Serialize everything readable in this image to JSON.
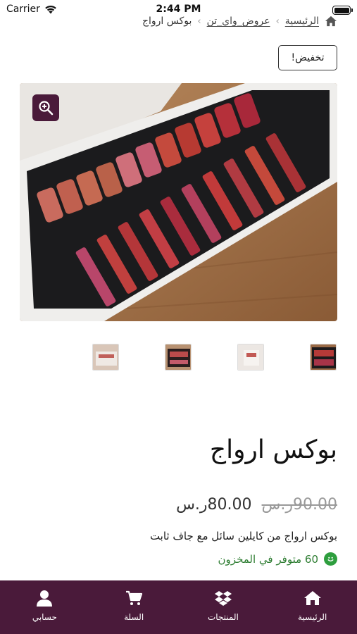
{
  "status_bar": {
    "carrier": "Carrier",
    "time": "2:44 PM"
  },
  "breadcrumb": {
    "home": "الرئيسية",
    "category": "عروض_واي_تن",
    "current": "بوكس ارواج",
    "separator": "›"
  },
  "discount_badge": "تخفيض!",
  "product": {
    "title": "بوكس ارواج",
    "price_old": "90.00ر.س",
    "price_new": "80.00ر.س",
    "description": "بوكس  ارواج من كايلين سائل مع جاف ثابت",
    "stock": "60 متوفر في المخزون"
  },
  "bottom_nav": {
    "home": "الرئيسية",
    "products": "المنتجات",
    "cart": "السلة",
    "account": "حسابي"
  },
  "colors": {
    "brand": "#4a1a3a",
    "in_stock": "#2e7d32"
  }
}
